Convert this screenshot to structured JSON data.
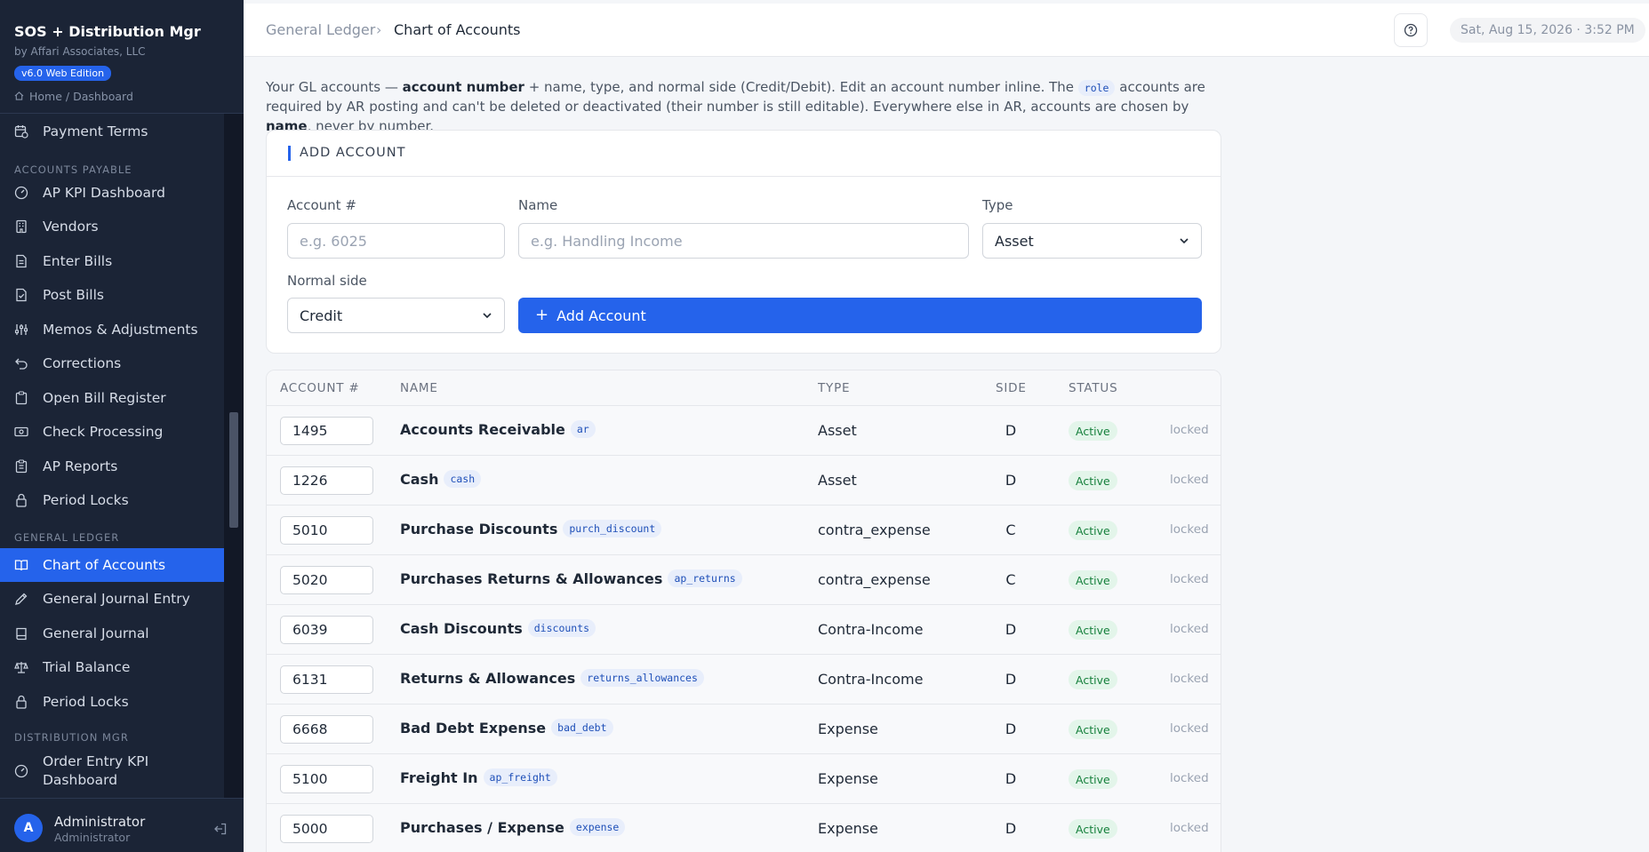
{
  "app": {
    "title": "SOS + Distribution Mgr",
    "subtitle": "by Affari Associates, LLC",
    "badge": "v6.0 Web Edition",
    "home_link": "Home / Dashboard"
  },
  "sidebar": {
    "items": [
      {
        "label": "Payment Terms",
        "icon": "calendar-clock-icon"
      },
      {
        "section": "ACCOUNTS PAYABLE"
      },
      {
        "label": "AP KPI Dashboard",
        "icon": "gauge-icon"
      },
      {
        "label": "Vendors",
        "icon": "building-icon"
      },
      {
        "label": "Enter Bills",
        "icon": "file-text-icon"
      },
      {
        "label": "Post Bills",
        "icon": "file-check-icon"
      },
      {
        "label": "Memos & Adjustments",
        "icon": "sliders-icon"
      },
      {
        "label": "Corrections",
        "icon": "undo-icon"
      },
      {
        "label": "Open Bill Register",
        "icon": "clipboard-icon"
      },
      {
        "label": "Check Processing",
        "icon": "banknote-icon"
      },
      {
        "label": "AP Reports",
        "icon": "clipboard-list-icon"
      },
      {
        "label": "Period Locks",
        "icon": "lock-icon"
      },
      {
        "section": "GENERAL LEDGER"
      },
      {
        "label": "Chart of Accounts",
        "icon": "book-open-icon",
        "active": true
      },
      {
        "label": "General Journal Entry",
        "icon": "pen-icon"
      },
      {
        "label": "General Journal",
        "icon": "book-icon"
      },
      {
        "label": "Trial Balance",
        "icon": "scale-icon"
      },
      {
        "label": "Period Locks",
        "icon": "lock-icon"
      },
      {
        "section": "DISTRIBUTION MGR"
      },
      {
        "label": "Order Entry KPI Dashboard",
        "icon": "gauge-icon"
      }
    ],
    "user": {
      "initial": "A",
      "name": "Administrator",
      "role": "Administrator"
    }
  },
  "header": {
    "breadcrumb_parent": "General Ledger",
    "breadcrumb_separator": "›",
    "breadcrumb_current": "Chart of Accounts",
    "datetime": "Sat, Aug 15, 2026 · 3:52 PM"
  },
  "intro": {
    "p1": "Your GL accounts — ",
    "b1": "account number",
    "p2": " + name, type, and normal side (Credit/Debit). Edit an account number inline. The ",
    "role": "role",
    "p3": " accounts are required by AR posting and can't be deleted or deactivated (their number is still editable). Everywhere else in AR, accounts are chosen by ",
    "b2": "name",
    "p4": ", never by number."
  },
  "add_form": {
    "title": "ADD ACCOUNT",
    "account_label": "Account #",
    "account_placeholder": "e.g. 6025",
    "name_label": "Name",
    "name_placeholder": "e.g. Handling Income",
    "type_label": "Type",
    "type_value": "Asset",
    "side_label": "Normal side",
    "side_value": "Credit",
    "submit": "Add Account"
  },
  "table": {
    "columns": [
      "ACCOUNT #",
      "NAME",
      "TYPE",
      "SIDE",
      "STATUS"
    ],
    "rows": [
      {
        "number": "1495",
        "name": "Accounts Receivable",
        "role": "ar",
        "type": "Asset",
        "side": "D",
        "status": "Active",
        "lock": "locked"
      },
      {
        "number": "1226",
        "name": "Cash",
        "role": "cash",
        "type": "Asset",
        "side": "D",
        "status": "Active",
        "lock": "locked"
      },
      {
        "number": "5010",
        "name": "Purchase Discounts",
        "role": "purch_discount",
        "type": "contra_expense",
        "side": "C",
        "status": "Active",
        "lock": "locked"
      },
      {
        "number": "5020",
        "name": "Purchases Returns & Allowances",
        "role": "ap_returns",
        "type": "contra_expense",
        "side": "C",
        "status": "Active",
        "lock": "locked"
      },
      {
        "number": "6039",
        "name": "Cash Discounts",
        "role": "discounts",
        "type": "Contra-Income",
        "side": "D",
        "status": "Active",
        "lock": "locked"
      },
      {
        "number": "6131",
        "name": "Returns & Allowances",
        "role": "returns_allowances",
        "type": "Contra-Income",
        "side": "D",
        "status": "Active",
        "lock": "locked"
      },
      {
        "number": "6668",
        "name": "Bad Debt Expense",
        "role": "bad_debt",
        "type": "Expense",
        "side": "D",
        "status": "Active",
        "lock": "locked"
      },
      {
        "number": "5100",
        "name": "Freight In",
        "role": "ap_freight",
        "type": "Expense",
        "side": "D",
        "status": "Active",
        "lock": "locked"
      },
      {
        "number": "5000",
        "name": "Purchases / Expense",
        "role": "expense",
        "type": "Expense",
        "side": "D",
        "status": "Active",
        "lock": "locked"
      }
    ]
  },
  "colors": {
    "sidebar_bg": "#1b2436",
    "accent": "#2563eb",
    "status_active_bg": "#e3f5ea",
    "status_active_text": "#16803c",
    "role_tag_bg": "#e8eefb"
  }
}
